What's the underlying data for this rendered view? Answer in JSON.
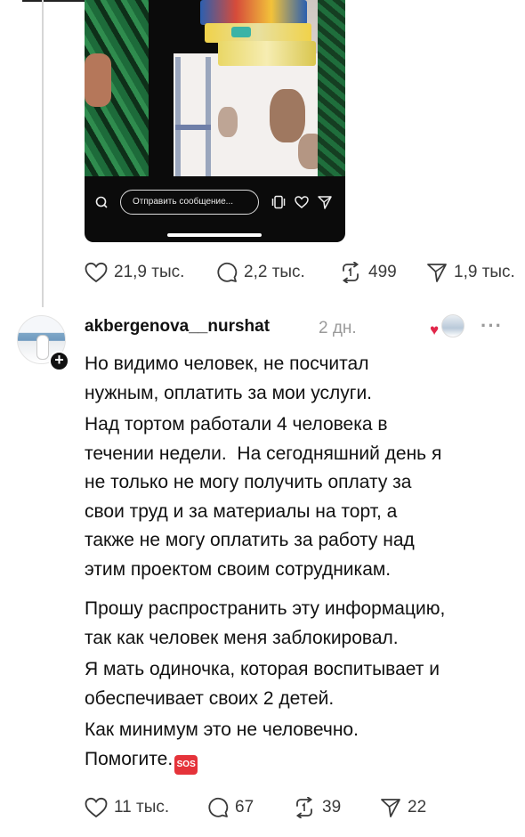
{
  "video": {
    "message_placeholder": "Отправить сообщение...",
    "icons": [
      "camera-icon",
      "stories-icon",
      "heart-icon",
      "send-icon"
    ]
  },
  "post_stats": {
    "likes": "21,9 тыс.",
    "replies": "2,2 тыс.",
    "reposts": "499",
    "shares": "1,9 тыс."
  },
  "comment": {
    "username": "akbergenova__nurshat",
    "time": "2 дн.",
    "lines_p1": [
      "Но видимо человек, не посчитал",
      "нужным, оплатить за мои услуги."
    ],
    "lines_p2": [
      "Над тортом работали 4 человека в",
      "течении недели.  На сегодняшний день я",
      "не только не могу получить оплату за",
      "свои труд и за материалы на торт, а",
      "также не могу оплатить за работу над",
      "этим проектом своим сотрудникам."
    ],
    "lines_p3": [
      "Прошу распространить эту информацию,",
      "так как человек меня заблокировал."
    ],
    "lines_p4": [
      "Я мать одиночка, которая воспитывает и",
      "обеспечивает своих 2 детей."
    ],
    "lines_p5": [
      "Как минимум это не человечно.",
      "Помогите."
    ],
    "sos_label": "SOS",
    "stats": {
      "likes": "11 тыс.",
      "replies": "67",
      "reposts": "39",
      "shares": "22"
    }
  },
  "colors": {
    "heart": "#e1264a",
    "sos": "#e5333a",
    "muted": "#9a9a9a"
  }
}
